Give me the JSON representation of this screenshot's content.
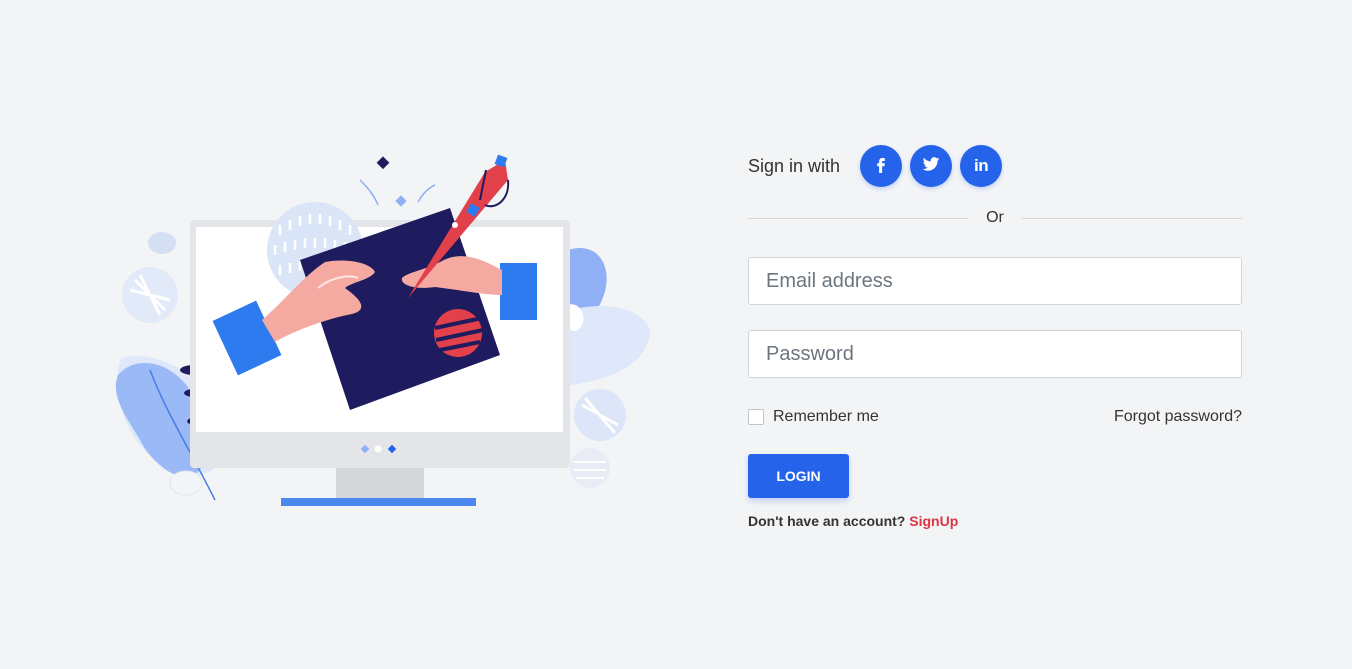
{
  "social": {
    "label": "Sign in with",
    "providers": [
      {
        "name": "facebook",
        "icon": "facebook-icon",
        "glyph": "f"
      },
      {
        "name": "twitter",
        "icon": "twitter-icon"
      },
      {
        "name": "linkedin",
        "icon": "linkedin-icon",
        "glyph": "in"
      }
    ]
  },
  "divider": {
    "label": "Or"
  },
  "email": {
    "placeholder": "Email address",
    "value": ""
  },
  "password": {
    "placeholder": "Password",
    "value": ""
  },
  "remember": {
    "label": "Remember me",
    "checked": false
  },
  "forgot": {
    "label": "Forgot password?"
  },
  "login": {
    "label": "LOGIN"
  },
  "signup": {
    "prompt": "Don't have an account? ",
    "link_label": "SignUp"
  },
  "colors": {
    "accent": "#2563eb",
    "signup_link": "#dc3545",
    "background": "#f3f4f6",
    "illustration_navy": "#1e1b5e",
    "illustration_red": "#e2414b"
  }
}
